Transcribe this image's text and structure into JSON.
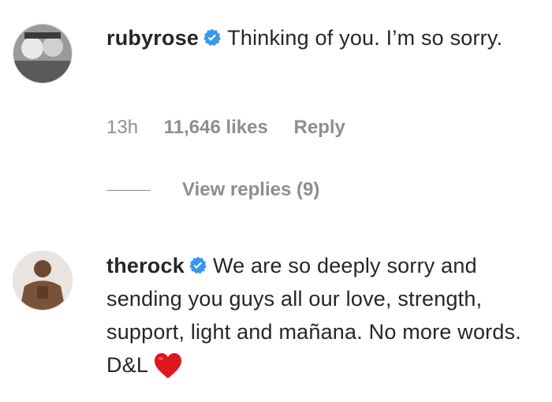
{
  "comments": [
    {
      "username": "rubyrose",
      "verified": true,
      "text": "Thinking of you. I’m so sorry.",
      "time": "13h",
      "likes": "11,646 likes",
      "reply_label": "Reply",
      "view_replies": "View replies (9)"
    },
    {
      "username": "therock",
      "verified": true,
      "text": "We are so deeply sorry and sending you guys all our love, strength, support, light and mañana. No more words. D&L",
      "emoji": "red-heart"
    }
  ],
  "colors": {
    "username": "#262626",
    "meta": "#8e8e8e",
    "verified": "#3897f0",
    "heart": "#e0161d"
  }
}
